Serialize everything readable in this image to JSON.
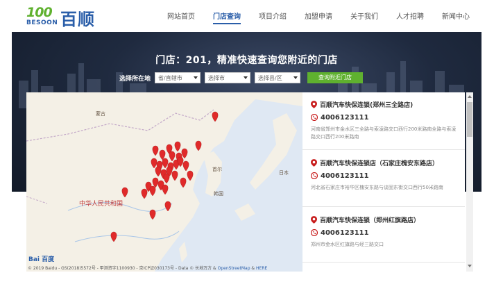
{
  "logo": {
    "number": "100",
    "brand_en": "BESOON",
    "brand_cn": "百顺"
  },
  "nav": [
    {
      "label": "网站首页",
      "active": false
    },
    {
      "label": "门店查询",
      "active": true
    },
    {
      "label": "项目介绍",
      "active": false
    },
    {
      "label": "加盟申请",
      "active": false
    },
    {
      "label": "关于我们",
      "active": false
    },
    {
      "label": "人才招聘",
      "active": false
    },
    {
      "label": "新闻中心",
      "active": false
    }
  ],
  "hero": {
    "title": "门店：201，精准快速查询您附近的门店",
    "filter_label": "选择所在地",
    "selects": [
      {
        "value": "省/直辖市"
      },
      {
        "value": "选择市"
      },
      {
        "value": "选择县/区"
      }
    ],
    "search_button": "查询附近门店"
  },
  "map": {
    "labels": {
      "mongolia": "蒙古",
      "china": "中华人民共和国",
      "seoul": "首尔",
      "korea": "韩国",
      "japan": "日本"
    },
    "logo": "Bai 百度",
    "attribution": {
      "prefix": "© 2019 Baidu - GS(2018)5572号 - 甲测资字1100930 - 京ICP证030173号 - Data © 长地万方 & ",
      "osm": "OpenStreetMap",
      "sep": " & ",
      "here": "HERE"
    },
    "marker_color": "#e02a2a"
  },
  "stores": [
    {
      "name": "百顺汽车快保连锁(郑州三全路店)",
      "phone": "4006123111",
      "address": "河南省郑州市金水区三全路与索凌路交口西行200米路南全路与索凌路交口西行200米路南"
    },
    {
      "name": "百顺汽车快保连锁店（石家庄槐安东路店）",
      "phone": "4006123111",
      "address": "河北省石家庄市裕华区槐安东路与谈固东街交口西行50米路南"
    },
    {
      "name": "百顺汽车快保连锁（郑州红旗路店）",
      "phone": "4006123111",
      "address": "郑州市金水区红旗路与经三路交口"
    }
  ],
  "colors": {
    "accent_blue": "#2a5ea9",
    "accent_green": "#5fb12f",
    "pin_red": "#e02a2a"
  }
}
